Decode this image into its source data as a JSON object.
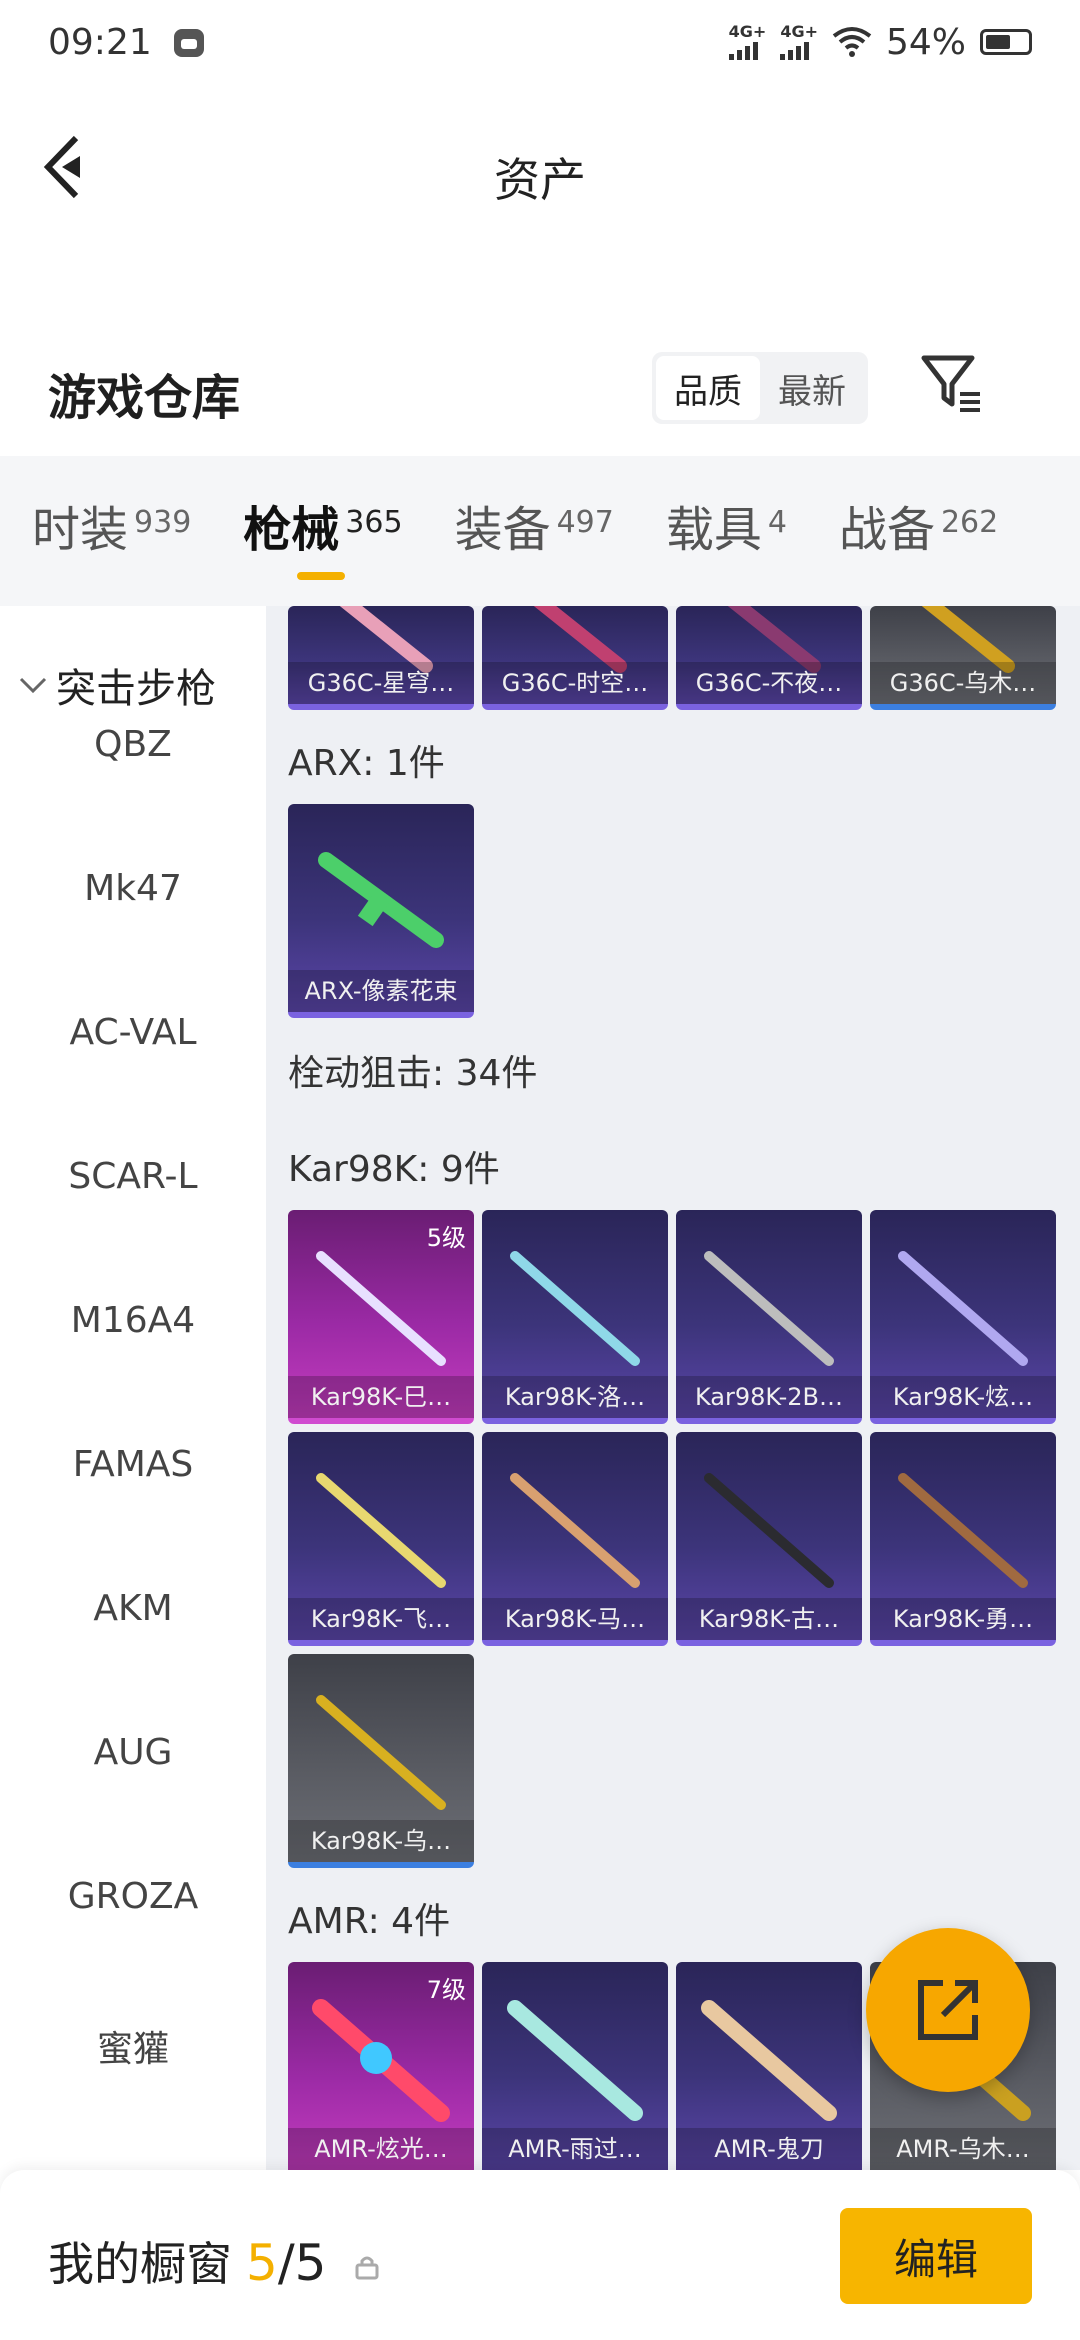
{
  "status_bar": {
    "time": "09:21",
    "signal_1": "4G+",
    "signal_2": "4G+",
    "battery": "54%"
  },
  "header": {
    "title": "资产"
  },
  "warehouse": {
    "title": "游戏仓库",
    "sort_options": [
      "品质",
      "最新"
    ],
    "sort_selected": "品质"
  },
  "tabs": [
    {
      "label": "时装",
      "count": "939"
    },
    {
      "label": "枪械",
      "count": "365",
      "active": true
    },
    {
      "label": "装备",
      "count": "497"
    },
    {
      "label": "载具",
      "count": "4"
    },
    {
      "label": "战备",
      "count": "262"
    }
  ],
  "sidebar": {
    "header": "突击步枪",
    "items": [
      "QBZ",
      "Mk47",
      "AC-VAL",
      "SCAR-L",
      "M16A4",
      "FAMAS",
      "AKM",
      "AUG",
      "GROZA",
      "蜜獾"
    ]
  },
  "content": {
    "top_row": [
      "G36C-星穹…",
      "G36C-时空…",
      "G36C-不夜…",
      "G36C-乌木…"
    ],
    "arx_label": "ARX: 1件",
    "arx_items": [
      "ARX-像素花束"
    ],
    "sniper_label": "栓动狙击: 34件",
    "kar_label": "Kar98K: 9件",
    "kar_items": [
      "Kar98K-巳…",
      "Kar98K-洛…",
      "Kar98K-2B…",
      "Kar98K-炫…",
      "Kar98K-飞…",
      "Kar98K-马…",
      "Kar98K-古…",
      "Kar98K-勇…",
      "Kar98K-乌…"
    ],
    "kar_level": "5级",
    "amr_label": "AMR: 4件",
    "amr_items": [
      "AMR-炫光…",
      "AMR-雨过…",
      "AMR-鬼刀",
      "AMR-乌木…"
    ],
    "amr_level": "7级"
  },
  "bottom": {
    "label": "我的橱窗",
    "count_current": "5",
    "count_total": "/5",
    "edit_label": "编辑"
  },
  "colors": {
    "accent": "#f4b000",
    "card_purple": "#3c347a",
    "card_pink": "#9b2aa5",
    "card_gray": "#5b5d64"
  }
}
